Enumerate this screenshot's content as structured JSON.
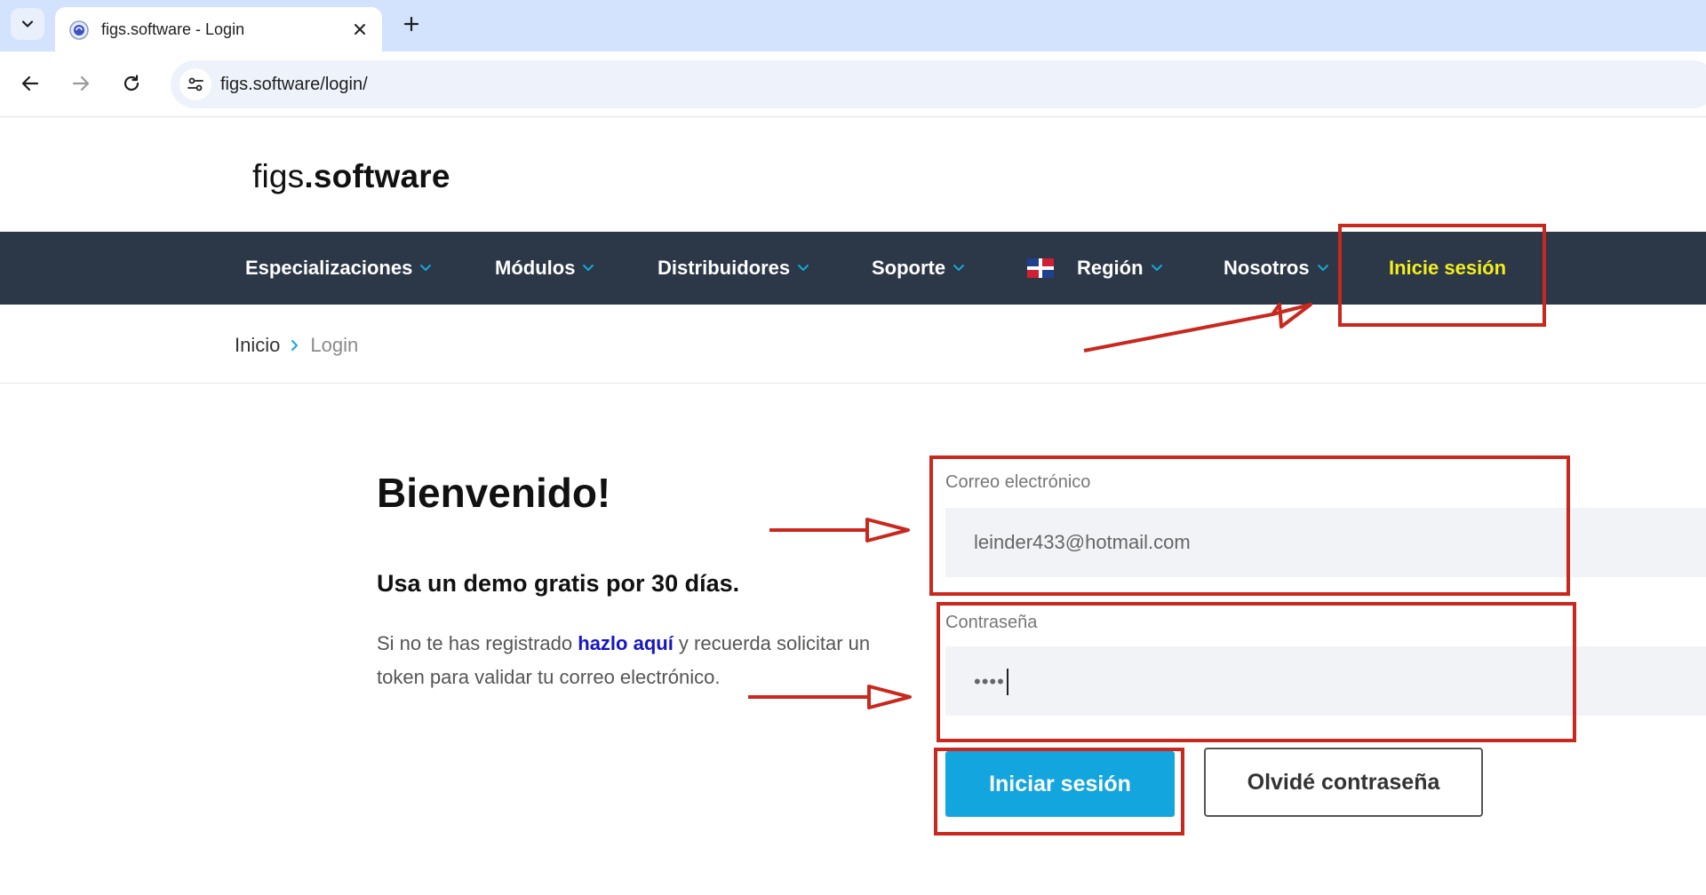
{
  "browser": {
    "tab_title": "figs.software - Login",
    "url": "figs.software/login/"
  },
  "site": {
    "logo_light": "figs",
    "logo_bold": ".software",
    "nav": [
      {
        "label": "Especializaciones"
      },
      {
        "label": "Módulos"
      },
      {
        "label": "Distribuidores"
      },
      {
        "label": "Soporte"
      },
      {
        "label": "Región"
      },
      {
        "label": "Nosotros"
      },
      {
        "label": "Inicie sesión"
      }
    ],
    "breadcrumb": {
      "home": "Inicio",
      "current": "Login"
    }
  },
  "login": {
    "heading": "Bienvenido!",
    "subheading": "Usa un demo gratis por 30 días.",
    "info_before": "Si no te has registrado ",
    "info_link": "hazlo aquí",
    "info_after": " y recuerda solicitar un token para validar tu correo electrónico.",
    "email_label": "Correo electrónico",
    "email_value": "leinder433@hotmail.com",
    "password_label": "Contraseña",
    "password_masked": "••••",
    "login_button": "Iniciar sesión",
    "forgot_button": "Olvidé contraseña"
  },
  "colors": {
    "nav_bg": "#2c3747",
    "login_link": "#f3ef1e",
    "primary_button": "#13a5dd",
    "annotation_red": "#c8281d",
    "chrome_tabstrip": "#d3e3fd"
  }
}
